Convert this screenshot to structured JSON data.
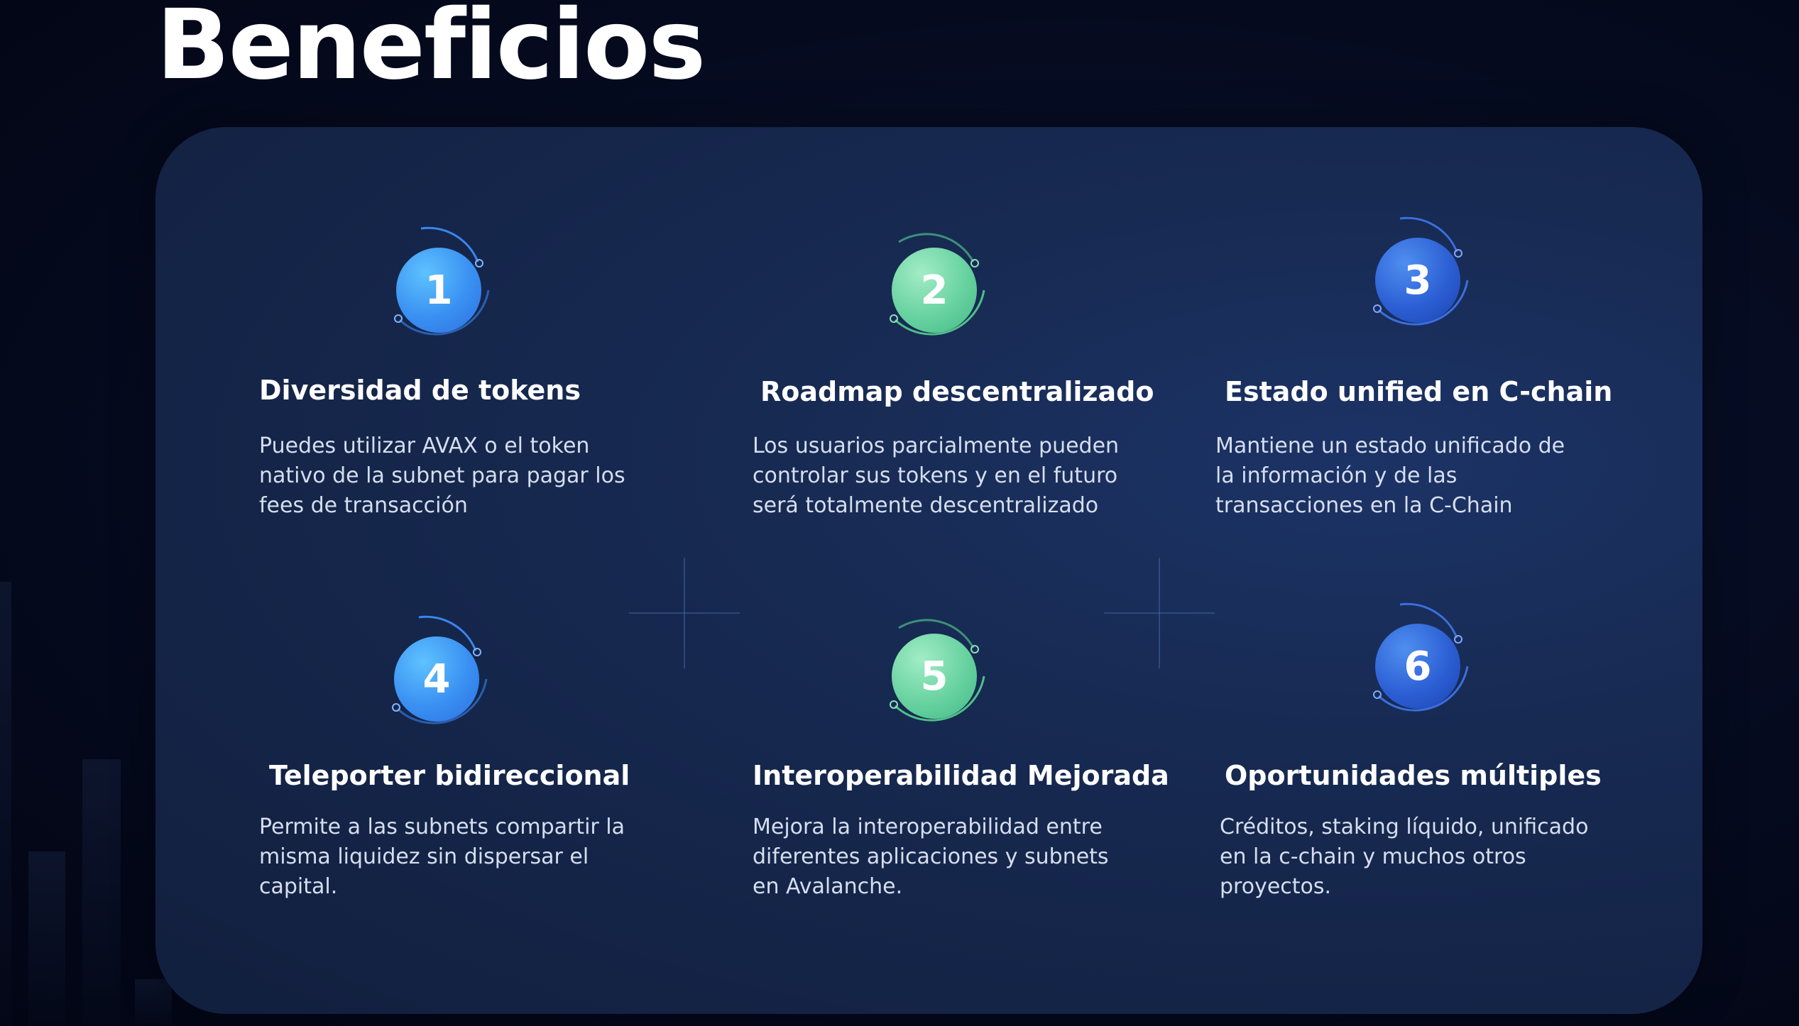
{
  "page": {
    "title": "Beneficios"
  },
  "benefits": [
    {
      "number": "1",
      "title": "Diversidad de tokens",
      "description": "Puedes utilizar AVAX o el token nativo de la subnet para pagar los fees de transacción",
      "color": "#4aa3ff"
    },
    {
      "number": "2",
      "title": "Roadmap descentralizado",
      "description": "Los usuarios parcialmente pueden controlar sus tokens y en el futuro será totalmente descentralizado",
      "color": "#6fd6a6"
    },
    {
      "number": "3",
      "title": "Estado unified en C-chain",
      "description": "Mantiene un estado unificado de la información y de las transacciones en la C-Chain",
      "color": "#2c5fd4"
    },
    {
      "number": "4",
      "title": "Teleporter bidireccional",
      "description": "Permite a las subnets compartir la misma liquidez sin dispersar el capital.",
      "color": "#4aa3ff"
    },
    {
      "number": "5",
      "title": "Interoperabilidad Mejorada",
      "description": "Mejora la interoperabilidad entre diferentes aplicaciones y subnets en Avalanche.",
      "color": "#6fd6a6"
    },
    {
      "number": "6",
      "title": "Oportunidades múltiples",
      "description": "Créditos, staking líquido, unificado en la c-chain y muchos otros proyectos.",
      "color": "#2c5fd4"
    }
  ]
}
